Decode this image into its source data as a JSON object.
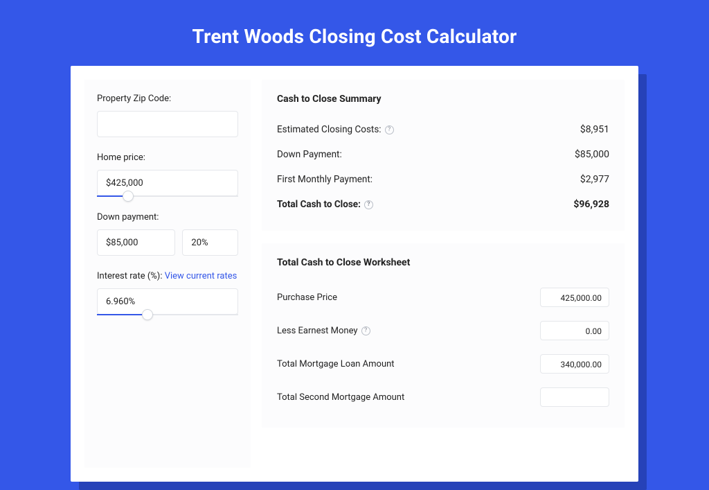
{
  "title": "Trent Woods Closing Cost Calculator",
  "left": {
    "zip_label": "Property Zip Code:",
    "zip_value": "",
    "home_price_label": "Home price:",
    "home_price_value": "$425,000",
    "down_payment_label": "Down payment:",
    "down_payment_value": "$85,000",
    "down_payment_pct": "20%",
    "interest_label": "Interest rate (%): ",
    "interest_link": "View current rates",
    "interest_value": "6.960%"
  },
  "summary": {
    "title": "Cash to Close Summary",
    "rows": [
      {
        "label": "Estimated Closing Costs:",
        "help": true,
        "value": "$8,951",
        "bold": false
      },
      {
        "label": "Down Payment:",
        "help": false,
        "value": "$85,000",
        "bold": false
      },
      {
        "label": "First Monthly Payment:",
        "help": false,
        "value": "$2,977",
        "bold": false
      },
      {
        "label": "Total Cash to Close:",
        "help": true,
        "value": "$96,928",
        "bold": true
      }
    ]
  },
  "worksheet": {
    "title": "Total Cash to Close Worksheet",
    "rows": [
      {
        "label": "Purchase Price",
        "help": false,
        "value": "425,000.00"
      },
      {
        "label": "Less Earnest Money",
        "help": true,
        "value": "0.00"
      },
      {
        "label": "Total Mortgage Loan Amount",
        "help": false,
        "value": "340,000.00"
      },
      {
        "label": "Total Second Mortgage Amount",
        "help": false,
        "value": ""
      }
    ]
  }
}
